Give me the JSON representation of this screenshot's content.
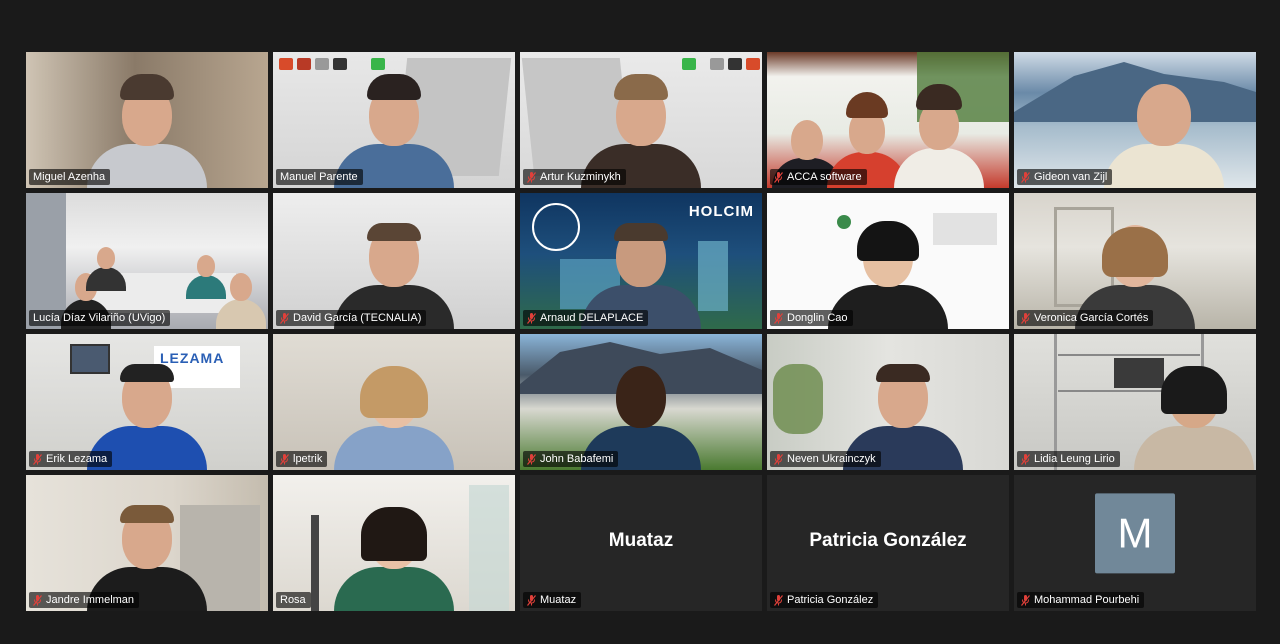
{
  "tiles": [
    {
      "name": "Miguel Azenha",
      "muted": false,
      "active": true
    },
    {
      "name": "Manuel Parente",
      "muted": false
    },
    {
      "name": "Artur Kuzminykh",
      "muted": true
    },
    {
      "name": "ACCA software",
      "muted": true
    },
    {
      "name": "Gideon van Zijl",
      "muted": true
    },
    {
      "name": "Lucía Díaz Vilariño (UVigo)",
      "muted": false
    },
    {
      "name": "David García (TECNALIA)",
      "muted": true
    },
    {
      "name": "Arnaud DELAPLACE",
      "muted": true
    },
    {
      "name": "Donglin Cao",
      "muted": true
    },
    {
      "name": "Veronica García Cortés",
      "muted": true
    },
    {
      "name": "Erik Lezama",
      "muted": true
    },
    {
      "name": "lpetrik",
      "muted": true
    },
    {
      "name": "John Babafemi",
      "muted": true
    },
    {
      "name": "Neven Ukrainczyk",
      "muted": true
    },
    {
      "name": "Lidia Leung Lirio",
      "muted": true
    },
    {
      "name": "Jandre Immelman",
      "muted": true
    },
    {
      "name": "Rosa",
      "muted": false
    },
    {
      "name": "Muataz",
      "muted": true,
      "video_off": true,
      "display_name": "Muataz"
    },
    {
      "name": "Patricia González",
      "muted": true,
      "video_off": true,
      "display_name": "Patricia González"
    },
    {
      "name": "Mohammad Pourbehi",
      "muted": true,
      "video_off": true,
      "avatar_letter": "M"
    }
  ],
  "overlays": {
    "holcim_logo": "HOLCIM",
    "lezama_sign": "LEZAMA"
  },
  "colors": {
    "background": "#1a1a1a",
    "active_border": "#d6e13d",
    "muted_icon": "#e0403a",
    "avatar_bg": "#718899"
  }
}
